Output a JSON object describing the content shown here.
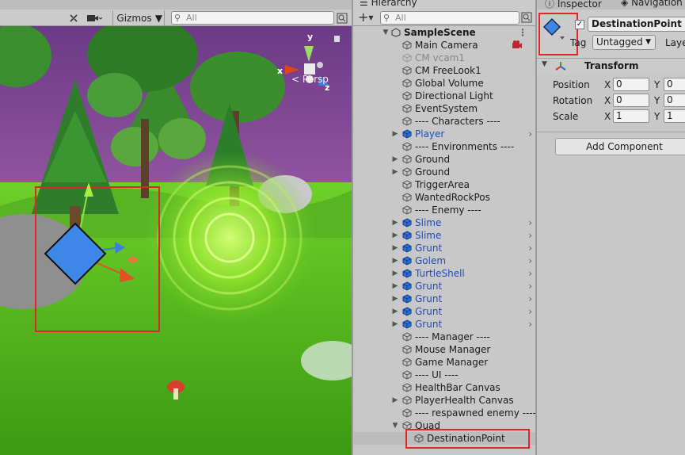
{
  "scene": {
    "gizmos_label": "Gizmos",
    "search_placeholder": "All",
    "persp_label": "Persp",
    "axis_labels": {
      "x": "x",
      "y": "y",
      "z": "z"
    }
  },
  "hierarchy": {
    "tab_label": "Hierarchy",
    "search_placeholder": "All",
    "scene_name": "SampleScene",
    "items": [
      {
        "label": "Main Camera",
        "fold": "",
        "chevron": false,
        "style": "normal"
      },
      {
        "label": "CM vcam1",
        "fold": "",
        "chevron": false,
        "style": "disabled"
      },
      {
        "label": "CM FreeLook1",
        "fold": "",
        "chevron": false,
        "style": "normal"
      },
      {
        "label": "Global Volume",
        "fold": "",
        "chevron": false,
        "style": "normal"
      },
      {
        "label": "Directional Light",
        "fold": "",
        "chevron": false,
        "style": "normal"
      },
      {
        "label": "EventSystem",
        "fold": "",
        "chevron": false,
        "style": "normal"
      },
      {
        "label": "---- Characters ----",
        "fold": "",
        "chevron": false,
        "style": "normal"
      },
      {
        "label": "Player",
        "fold": "▶",
        "chevron": true,
        "style": "prefab"
      },
      {
        "label": "---- Environments ----",
        "fold": "",
        "chevron": false,
        "style": "normal"
      },
      {
        "label": "Ground",
        "fold": "▶",
        "chevron": false,
        "style": "normal"
      },
      {
        "label": "Ground",
        "fold": "▶",
        "chevron": false,
        "style": "normal"
      },
      {
        "label": "TriggerArea",
        "fold": "",
        "chevron": false,
        "style": "normal"
      },
      {
        "label": "WantedRockPos",
        "fold": "",
        "chevron": false,
        "style": "normal"
      },
      {
        "label": "---- Enemy ----",
        "fold": "",
        "chevron": false,
        "style": "normal"
      },
      {
        "label": "Slime",
        "fold": "▶",
        "chevron": true,
        "style": "prefab"
      },
      {
        "label": "Slime",
        "fold": "▶",
        "chevron": true,
        "style": "prefab"
      },
      {
        "label": "Grunt",
        "fold": "▶",
        "chevron": true,
        "style": "prefab"
      },
      {
        "label": "Golem",
        "fold": "▶",
        "chevron": true,
        "style": "prefab"
      },
      {
        "label": "TurtleShell",
        "fold": "▶",
        "chevron": true,
        "style": "prefab"
      },
      {
        "label": "Grunt",
        "fold": "▶",
        "chevron": true,
        "style": "prefab"
      },
      {
        "label": "Grunt",
        "fold": "▶",
        "chevron": true,
        "style": "prefab"
      },
      {
        "label": "Grunt",
        "fold": "▶",
        "chevron": true,
        "style": "prefab"
      },
      {
        "label": "Grunt",
        "fold": "▶",
        "chevron": true,
        "style": "prefab"
      },
      {
        "label": "---- Manager ----",
        "fold": "",
        "chevron": false,
        "style": "normal"
      },
      {
        "label": "Mouse Manager",
        "fold": "",
        "chevron": false,
        "style": "normal"
      },
      {
        "label": "Game Manager",
        "fold": "",
        "chevron": false,
        "style": "normal"
      },
      {
        "label": "---- UI ----",
        "fold": "",
        "chevron": false,
        "style": "normal"
      },
      {
        "label": "HealthBar Canvas",
        "fold": "",
        "chevron": false,
        "style": "normal"
      },
      {
        "label": "PlayerHealth Canvas",
        "fold": "▶",
        "chevron": false,
        "style": "normal"
      },
      {
        "label": "---- respawned enemy ----",
        "fold": "",
        "chevron": false,
        "style": "normal"
      },
      {
        "label": "Quad",
        "fold": "▼",
        "chevron": false,
        "style": "normal"
      }
    ],
    "selected_child": "DestinationPoint"
  },
  "inspector": {
    "tab_inspector": "Inspector",
    "tab_navigation": "Navigation",
    "object_name": "DestinationPoint",
    "active_check": "✓",
    "tag_label": "Tag",
    "tag_value": "Untagged",
    "layer_label": "Laye",
    "transform_title": "Transform",
    "position_label": "Position",
    "rotation_label": "Rotation",
    "scale_label": "Scale",
    "axis_x": "X",
    "axis_y": "Y",
    "position": {
      "x": "0",
      "y": "0"
    },
    "rotation": {
      "x": "0",
      "y": "0"
    },
    "scale": {
      "x": "1",
      "y": "1"
    },
    "add_component_label": "Add Component"
  },
  "colors": {
    "selection_highlight": "#e0262b",
    "prefab_text": "#1c4db8",
    "sky": "#7a3f8f",
    "grass": "#5fbf1a"
  }
}
